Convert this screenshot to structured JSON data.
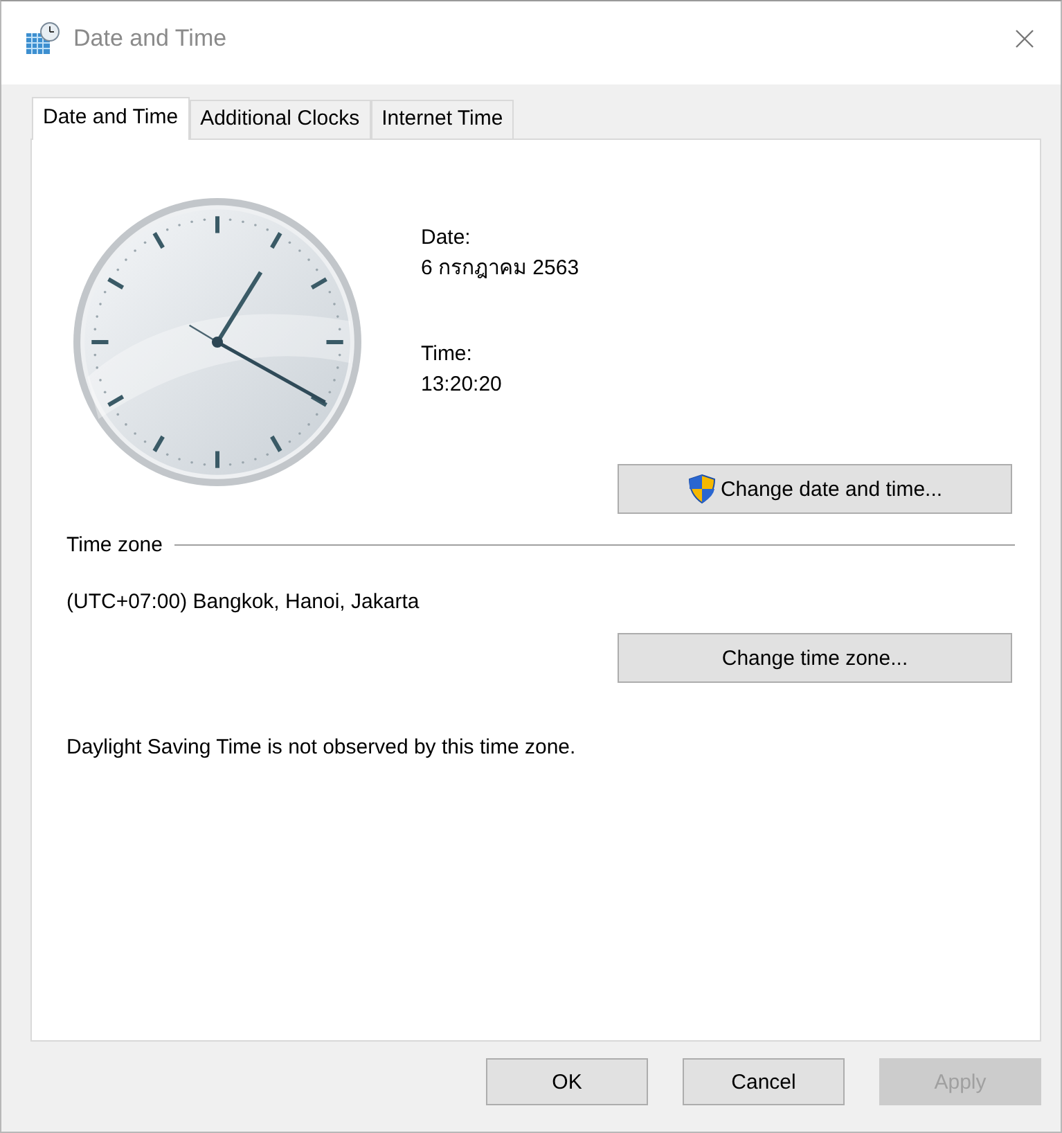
{
  "window": {
    "title": "Date and Time"
  },
  "tabs": [
    {
      "label": "Date and Time",
      "selected": true
    },
    {
      "label": "Additional Clocks",
      "selected": false
    },
    {
      "label": "Internet Time",
      "selected": false
    }
  ],
  "date_time": {
    "date_label": "Date:",
    "date": "6 กรกฎาคม 2563",
    "time_label": "Time:",
    "time": "13:20:20",
    "change_button": "Change date and time..."
  },
  "time_zone": {
    "heading": "Time zone",
    "value": "(UTC+07:00) Bangkok, Hanoi, Jakarta",
    "change_button": "Change time zone..."
  },
  "dst_note": "Daylight Saving Time is not observed by this time zone.",
  "buttons": [
    {
      "label": "OK",
      "disabled": false
    },
    {
      "label": "Cancel",
      "disabled": false
    },
    {
      "label": "Apply",
      "disabled": true
    }
  ]
}
